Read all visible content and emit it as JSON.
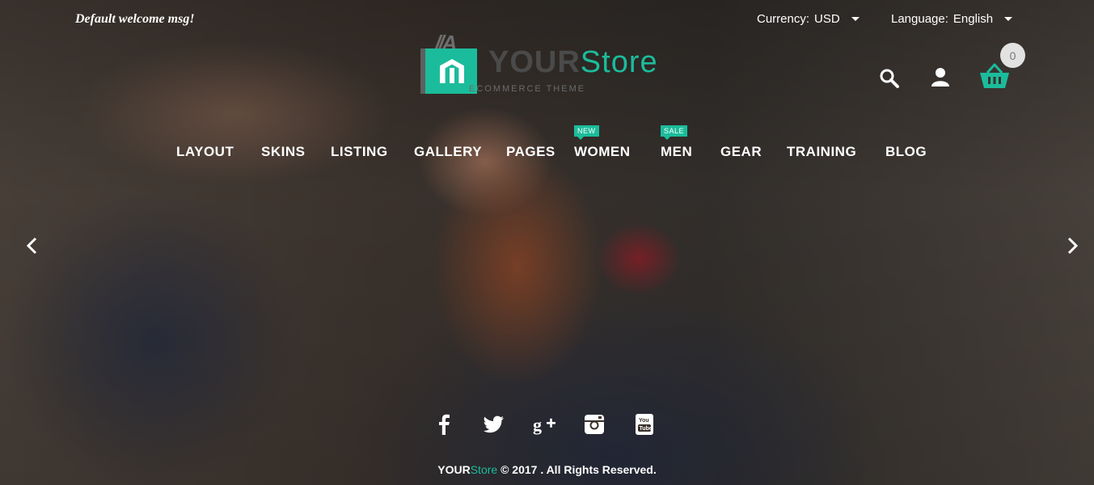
{
  "header": {
    "welcome": "Default welcome msg!",
    "currency": {
      "label": "Currency:",
      "value": "USD"
    },
    "language": {
      "label": "Language:",
      "value": "English"
    },
    "logo": {
      "your": "YOUR",
      "store": "Store",
      "tagline": "ECOMMERCE THEME"
    },
    "cart_count": "0",
    "icons": {
      "search": "search-icon",
      "account": "user-icon",
      "cart": "cart-icon"
    }
  },
  "nav": {
    "items": [
      {
        "label": "LAYOUT"
      },
      {
        "label": "SKINS"
      },
      {
        "label": "LISTING"
      },
      {
        "label": "GALLERY"
      },
      {
        "label": "PAGES"
      },
      {
        "label": "WOMEN",
        "badge": "NEW"
      },
      {
        "label": "MEN",
        "badge": "SALE"
      },
      {
        "label": "GEAR"
      },
      {
        "label": "TRAINING"
      },
      {
        "label": "BLOG"
      }
    ]
  },
  "slider": {
    "prev_icon": "chevron-left-icon",
    "next_icon": "chevron-right-icon"
  },
  "social": [
    "facebook-icon",
    "twitter-icon",
    "google-plus-icon",
    "instagram-icon",
    "youtube-icon"
  ],
  "footer": {
    "brand_your": "YOUR",
    "brand_store": "Store",
    "copyright_text": " © 2017 . All Rights Reserved."
  },
  "colors": {
    "accent": "#1bbc9b",
    "logo_dark": "#4a4a4a"
  }
}
